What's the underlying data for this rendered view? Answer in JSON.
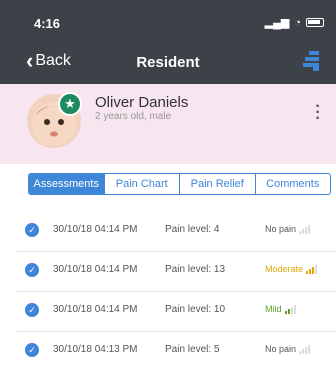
{
  "status_bar": {
    "time": "4:16"
  },
  "nav": {
    "back_label": "Back",
    "title": "Resident"
  },
  "resident": {
    "name": "Oliver Daniels",
    "subtitle": "2 years old, male"
  },
  "tabs": [
    {
      "label": "Assessments",
      "active": true
    },
    {
      "label": "Pain Chart",
      "active": false
    },
    {
      "label": "Pain Relief",
      "active": false
    },
    {
      "label": "Comments",
      "active": false
    }
  ],
  "assessments": [
    {
      "timestamp": "30/10/18 04:14 PM",
      "pain_level": "Pain level: 4",
      "severity": "No pain",
      "severity_color": "#555555",
      "bars_filled": 0
    },
    {
      "timestamp": "30/10/18 04:14 PM",
      "pain_level": "Pain level: 13",
      "severity": "Moderate",
      "severity_color": "#e0a800",
      "bars_filled": 3
    },
    {
      "timestamp": "30/10/18 04:14 PM",
      "pain_level": "Pain level: 10",
      "severity": "Mild",
      "severity_color": "#5aa02c",
      "bars_filled": 2
    },
    {
      "timestamp": "30/10/18 04:13 PM",
      "pain_level": "Pain level: 5",
      "severity": "No pain",
      "severity_color": "#555555",
      "bars_filled": 0
    }
  ],
  "colors": {
    "header_bg": "#3d4248",
    "accent": "#3d86d8",
    "profile_bg": "#f7e6ef",
    "badge": "#1e8a5f"
  }
}
